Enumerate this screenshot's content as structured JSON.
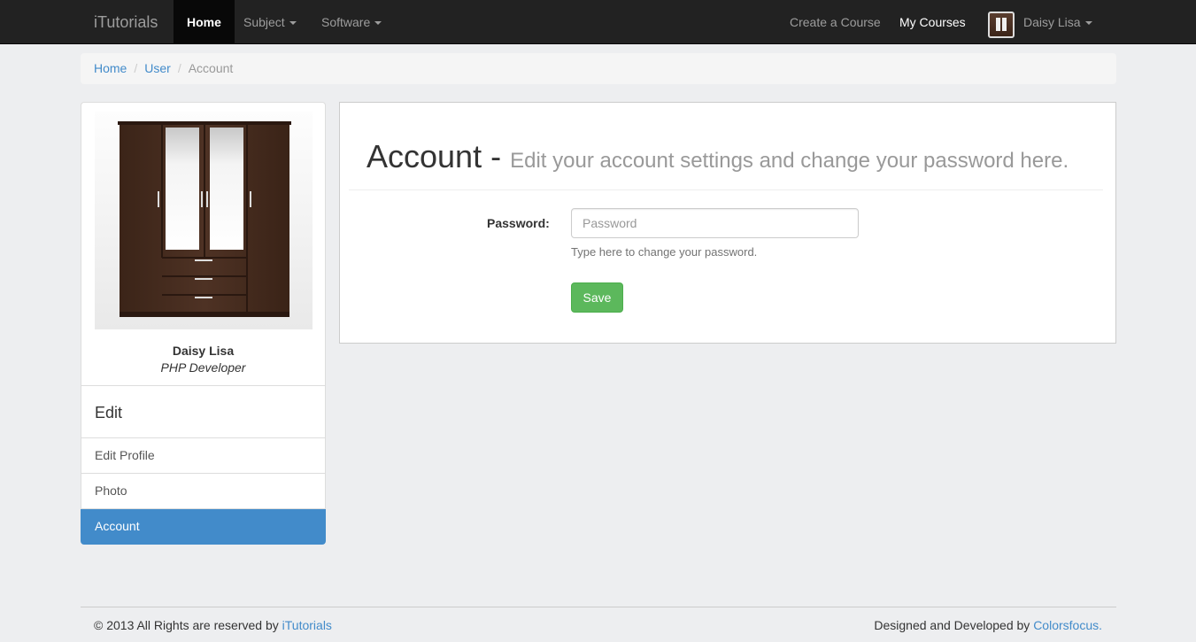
{
  "navbar": {
    "brand": "iTutorials",
    "items": [
      {
        "label": "Home"
      },
      {
        "label": "Subject"
      },
      {
        "label": "Software"
      }
    ],
    "right": {
      "create_course": "Create a Course",
      "my_courses": "My Courses",
      "user_name": "Daisy Lisa",
      "avatar_icon": "wardrobe-thumbnail"
    }
  },
  "breadcrumb": {
    "items": [
      "Home",
      "User"
    ],
    "current": "Account",
    "separator": "/"
  },
  "profile": {
    "name": "Daisy Lisa",
    "role": "PHP Developer"
  },
  "sidebar_menu": {
    "heading": "Edit",
    "items": [
      {
        "label": "Edit Profile"
      },
      {
        "label": "Photo"
      },
      {
        "label": "Account"
      }
    ]
  },
  "main": {
    "title": "Account -",
    "subtitle": "Edit your account settings and change your password here.",
    "password_label": "Password:",
    "password_placeholder": "Password",
    "password_value": "",
    "help_text": "Type here to change your password.",
    "save_label": "Save"
  },
  "footer": {
    "left_text": "© 2013 All Rights are reserved by ",
    "left_link": "iTutorials",
    "right_text": "Designed and Developed by ",
    "right_link": "Colorsfocus",
    "right_suffix": "."
  },
  "colors": {
    "navbar_bg": "#222222",
    "link": "#428bca",
    "active_item": "#428bca",
    "save_button": "#5cb85c",
    "page_bg": "#edeef0"
  }
}
